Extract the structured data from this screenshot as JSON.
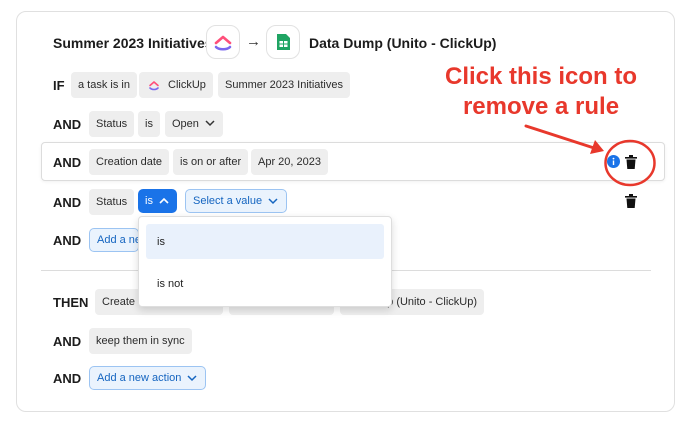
{
  "header": {
    "source_name": "Summer 2023 Initiatives",
    "arrow": "→",
    "target_name": "Data Dump (Unito - ClickUp)",
    "source_icon": "clickup-logo-icon",
    "target_icon": "google-sheets-icon"
  },
  "rules": {
    "if_keyword": "IF",
    "and_keyword": "AND",
    "then_keyword": "THEN",
    "if_row": {
      "subject": "a task is in",
      "app": "ClickUp",
      "list": "Summer 2023 Initiatives"
    },
    "row1": {
      "field": "Status",
      "op": "is",
      "value": "Open"
    },
    "row2": {
      "field": "Creation date",
      "op": "is on or after",
      "value": "Apr 20, 2023"
    },
    "row3": {
      "field": "Status",
      "op": "is",
      "value_placeholder": "Select a value"
    },
    "add_rule": "Add a new",
    "dropdown_options": [
      "is",
      "is not"
    ]
  },
  "actions": {
    "create_prefix": "Create a",
    "create_suffix": "p (Unito - ClickUp)",
    "sync": "keep them in sync",
    "add_action": "Add a new action"
  },
  "annotation": {
    "text_line1": "Click this icon to",
    "text_line2": "remove a rule",
    "color": "#e8382c"
  },
  "colors": {
    "accent": "#1a73e8",
    "annotation": "#e8382c"
  }
}
